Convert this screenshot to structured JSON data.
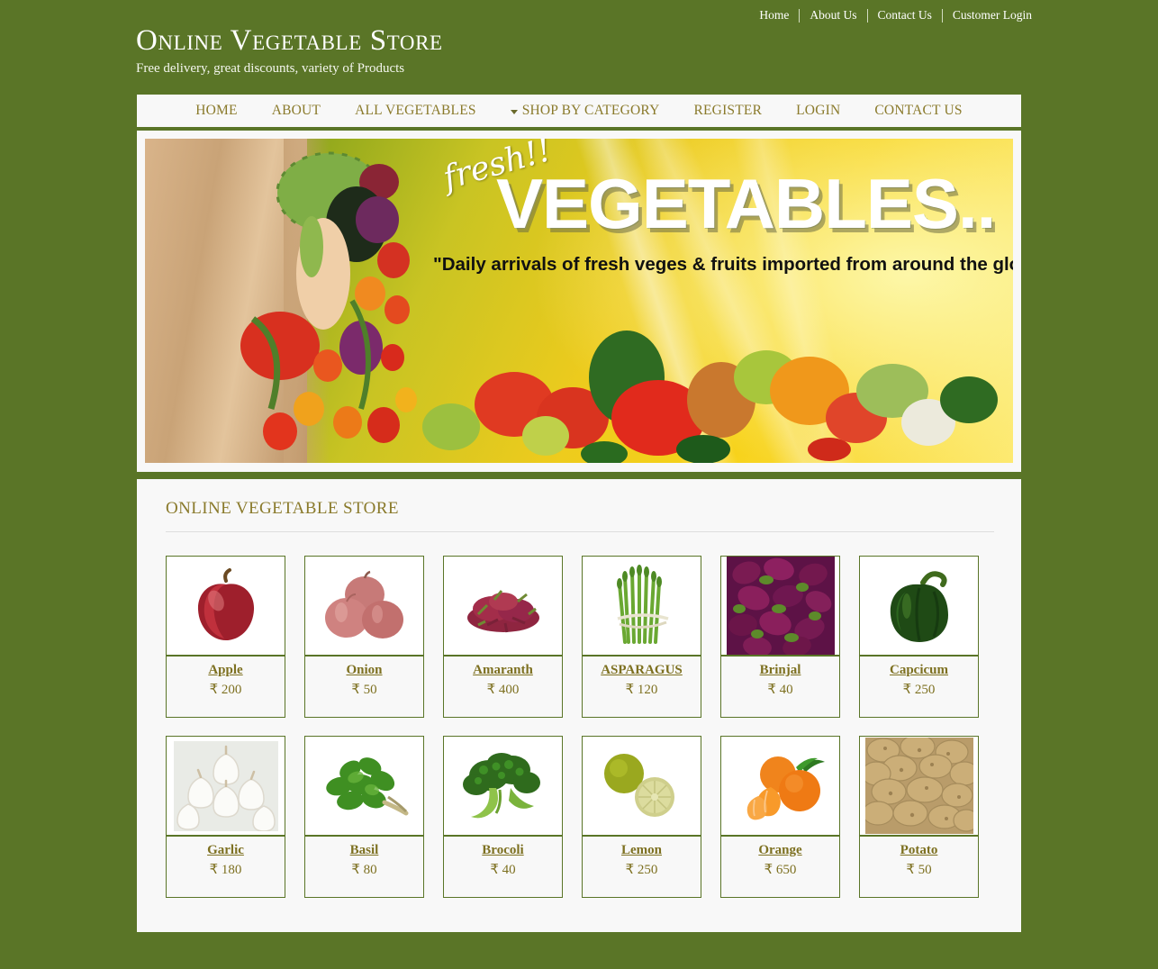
{
  "topbar": {
    "links": [
      {
        "label": "Home"
      },
      {
        "label": "About Us"
      },
      {
        "label": "Contact Us"
      },
      {
        "label": "Customer Login"
      }
    ]
  },
  "brand": {
    "title": "Online Vegetable Store",
    "subtitle": "Free delivery, great discounts, variety of Products"
  },
  "nav": {
    "items": [
      {
        "label": "HOME",
        "caret": false
      },
      {
        "label": "ABOUT",
        "caret": false
      },
      {
        "label": "ALL VEGETABLES",
        "caret": false
      },
      {
        "label": "SHOP BY CATEGORY",
        "caret": true
      },
      {
        "label": "REGISTER",
        "caret": false
      },
      {
        "label": "LOGIN",
        "caret": false
      },
      {
        "label": "CONTACT US",
        "caret": false
      }
    ]
  },
  "banner": {
    "script_text": "fresh!!",
    "title": "VEGETABLES..",
    "tagline": "\"Daily arrivals of fresh veges & fruits imported from around the globe\""
  },
  "main": {
    "section_title": "ONLINE VEGETABLE STORE",
    "currency_symbol": "₹",
    "products": [
      {
        "name": "Apple",
        "price": "₹ 200",
        "icon": "apple-image"
      },
      {
        "name": "Onion",
        "price": "₹ 50",
        "icon": "onion-image"
      },
      {
        "name": "Amaranth",
        "price": "₹ 400",
        "icon": "amaranth-image"
      },
      {
        "name": "ASPARAGUS",
        "price": "₹ 120",
        "icon": "asparagus-image"
      },
      {
        "name": "Brinjal",
        "price": "₹ 40",
        "icon": "brinjal-image"
      },
      {
        "name": "Capcicum",
        "price": "₹ 250",
        "icon": "capsicum-image"
      },
      {
        "name": "Garlic",
        "price": "₹ 180",
        "icon": "garlic-image"
      },
      {
        "name": "Basil",
        "price": "₹ 80",
        "icon": "basil-image"
      },
      {
        "name": "Brocoli",
        "price": "₹ 40",
        "icon": "broccoli-image"
      },
      {
        "name": "Lemon",
        "price": "₹ 250",
        "icon": "lemon-image"
      },
      {
        "name": "Orange",
        "price": "₹ 650",
        "icon": "orange-image"
      },
      {
        "name": "Potato",
        "price": "₹ 50",
        "icon": "potato-image"
      }
    ]
  },
  "colors": {
    "page_background": "#5a7527",
    "panel_background": "#f8f8f8",
    "accent_text": "#8a7a2b",
    "border": "#5a7527"
  }
}
